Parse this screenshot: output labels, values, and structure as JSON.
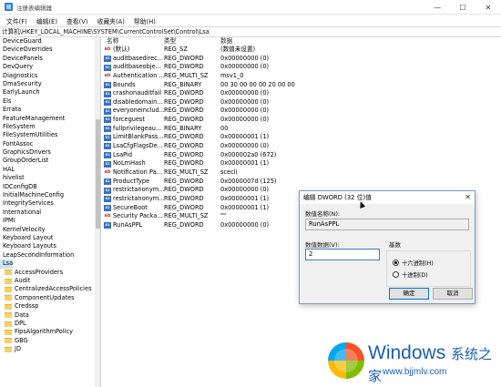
{
  "window": {
    "title": "注册表编辑器",
    "controls": [
      "—",
      "☐",
      "✕"
    ]
  },
  "menu": [
    "文件(F)",
    "编辑(E)",
    "查看(V)",
    "收藏夹(A)",
    "帮助(H)"
  ],
  "address": "计算机\\HKEY_LOCAL_MACHINE\\SYSTEM\\CurrentControlSet\\Control\\Lsa",
  "tree": {
    "items": [
      "DeviceGuard",
      "DeviceOverrides",
      "DevicePanels",
      "DevQuery",
      "Diagnostics",
      "DmaSecurity",
      "EarlyLaunch",
      "Els",
      "Errata",
      "FeatureManagement",
      "FileSystem",
      "FileSystemUtilities",
      "FontAssoc",
      "GraphicsDrivers",
      "GroupOrderList",
      "HAL",
      "hivelist",
      "IDConfigDB",
      "InitialMachineConfig",
      "IntegrityServices",
      "International",
      "IPMI",
      "KernelVelocity",
      "Keyboard Layout",
      "Keyboard Layouts",
      "LeapSecondInformation"
    ],
    "selected": "Lsa",
    "children": [
      "AccessProviders",
      "Audit",
      "CentralizedAccessPolicies",
      "ComponentUpdates",
      "Credssp",
      "Data",
      "DPL",
      "FipsAlgorithmPolicy",
      "GBG",
      "JD"
    ]
  },
  "list": {
    "headers": {
      "name": "名称",
      "type": "类型",
      "data": "数据"
    },
    "rows": [
      {
        "icon": "ab",
        "name": "(默认)",
        "type": "REG_SZ",
        "data": "(数值未设置)"
      },
      {
        "icon": "bin",
        "name": "auditbasedirec...",
        "type": "REG_DWORD",
        "data": "0x00000000 (0)"
      },
      {
        "icon": "bin",
        "name": "auditbaseobje...",
        "type": "REG_DWORD",
        "data": "0x00000000 (0)"
      },
      {
        "icon": "ab",
        "name": "Authentication ...",
        "type": "REG_MULTI_SZ",
        "data": "msv1_0"
      },
      {
        "icon": "bin",
        "name": "Bounds",
        "type": "REG_BINARY",
        "data": "00 30 00 00 00 20 00 00"
      },
      {
        "icon": "bin",
        "name": "crashonauditfail",
        "type": "REG_DWORD",
        "data": "0x00000000 (0)"
      },
      {
        "icon": "bin",
        "name": "disabledomain...",
        "type": "REG_DWORD",
        "data": "0x00000000 (0)"
      },
      {
        "icon": "bin",
        "name": "everyoneinclud...",
        "type": "REG_DWORD",
        "data": "0x00000000 (0)"
      },
      {
        "icon": "bin",
        "name": "forceguest",
        "type": "REG_DWORD",
        "data": "0x00000000 (0)"
      },
      {
        "icon": "bin",
        "name": "fullprivilegeau...",
        "type": "REG_BINARY",
        "data": "00"
      },
      {
        "icon": "bin",
        "name": "LimitBlankPass...",
        "type": "REG_DWORD",
        "data": "0x00000001 (1)"
      },
      {
        "icon": "bin",
        "name": "LsaCfgFlagsDe...",
        "type": "REG_DWORD",
        "data": "0x00000000 (0)"
      },
      {
        "icon": "bin",
        "name": "LsaPid",
        "type": "REG_DWORD",
        "data": "0x000002a0 (672)"
      },
      {
        "icon": "bin",
        "name": "NoLmHash",
        "type": "REG_DWORD",
        "data": "0x00000001 (1)"
      },
      {
        "icon": "ab",
        "name": "Notification Pa...",
        "type": "REG_MULTI_SZ",
        "data": "scecli"
      },
      {
        "icon": "bin",
        "name": "ProductType",
        "type": "REG_DWORD",
        "data": "0x0000007d (125)"
      },
      {
        "icon": "bin",
        "name": "restrictanonym...",
        "type": "REG_DWORD",
        "data": "0x00000000 (0)"
      },
      {
        "icon": "bin",
        "name": "restrictanonym...",
        "type": "REG_DWORD",
        "data": "0x00000001 (1)"
      },
      {
        "icon": "bin",
        "name": "SecureBoot",
        "type": "REG_DWORD",
        "data": "0x00000001 (1)"
      },
      {
        "icon": "ab",
        "name": "Security Packa...",
        "type": "REG_MULTI_SZ",
        "data": "\"\""
      },
      {
        "icon": "bin",
        "name": "RunAsPPL",
        "type": "REG_DWORD",
        "data": "0x00000000 (0)"
      }
    ]
  },
  "dialog": {
    "title": "编辑 DWORD (32 位)值",
    "close": "✕",
    "name_label": "数值名称(N):",
    "name_value": "RunAsPPL",
    "data_label": "数值数据(V):",
    "data_value": "2",
    "base_label": "基数",
    "radio_hex": "十六进制(H)",
    "radio_dec": "十进制(D)",
    "ok": "确定",
    "cancel": "取消"
  },
  "watermark": {
    "brand": "Windows",
    "cn": "系统之家",
    "url": "www.bjjmlv.com"
  }
}
